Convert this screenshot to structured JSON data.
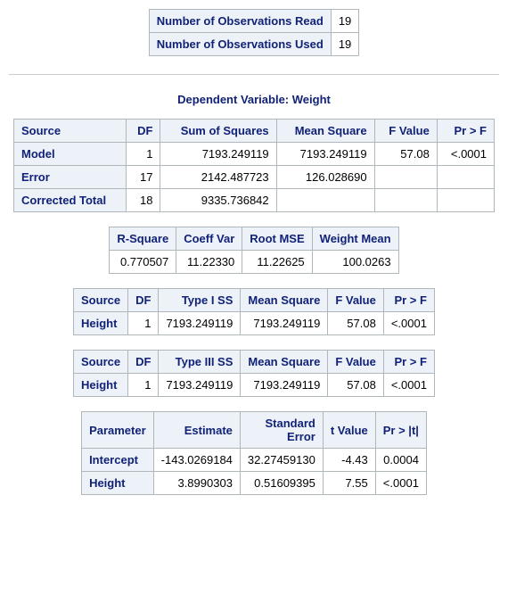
{
  "obs_read_label": "Number of Observations Read",
  "obs_read_value": "19",
  "obs_used_label": "Number of Observations Used",
  "obs_used_value": "19",
  "depvar_title": "Dependent Variable: Weight",
  "anova": {
    "headers": {
      "source": "Source",
      "df": "DF",
      "ss": "Sum of Squares",
      "ms": "Mean Square",
      "f": "F Value",
      "pr": "Pr > F"
    },
    "rows": [
      {
        "source": "Model",
        "df": "1",
        "ss": "7193.249119",
        "ms": "7193.249119",
        "f": "57.08",
        "pr": "<.0001"
      },
      {
        "source": "Error",
        "df": "17",
        "ss": "2142.487723",
        "ms": "126.028690",
        "f": "",
        "pr": ""
      },
      {
        "source": "Corrected Total",
        "df": "18",
        "ss": "9335.736842",
        "ms": "",
        "f": "",
        "pr": ""
      }
    ]
  },
  "fit": {
    "headers": {
      "rsq": "R-Square",
      "cv": "Coeff Var",
      "rmse": "Root MSE",
      "mean": "Weight Mean"
    },
    "row": {
      "rsq": "0.770507",
      "cv": "11.22330",
      "rmse": "11.22625",
      "mean": "100.0263"
    }
  },
  "type1": {
    "headers": {
      "source": "Source",
      "df": "DF",
      "ss": "Type I SS",
      "ms": "Mean Square",
      "f": "F Value",
      "pr": "Pr > F"
    },
    "rows": [
      {
        "source": "Height",
        "df": "1",
        "ss": "7193.249119",
        "ms": "7193.249119",
        "f": "57.08",
        "pr": "<.0001"
      }
    ]
  },
  "type3": {
    "headers": {
      "source": "Source",
      "df": "DF",
      "ss": "Type III SS",
      "ms": "Mean Square",
      "f": "F Value",
      "pr": "Pr > F"
    },
    "rows": [
      {
        "source": "Height",
        "df": "1",
        "ss": "7193.249119",
        "ms": "7193.249119",
        "f": "57.08",
        "pr": "<.0001"
      }
    ]
  },
  "params": {
    "headers": {
      "param": "Parameter",
      "est": "Estimate",
      "se": "Standard\nError",
      "t": "t Value",
      "pr": "Pr > |t|"
    },
    "rows": [
      {
        "param": "Intercept",
        "est": "-143.0269184",
        "se": "32.27459130",
        "t": "-4.43",
        "pr": "0.0004"
      },
      {
        "param": "Height",
        "est": "3.8990303",
        "se": "0.51609395",
        "t": "7.55",
        "pr": "<.0001"
      }
    ]
  }
}
